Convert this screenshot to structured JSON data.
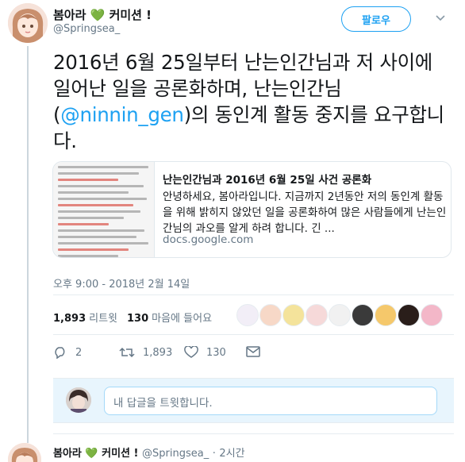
{
  "author": {
    "name": "봄아라",
    "badge": "커미션 !",
    "heart": "💚",
    "handle": "@Springsea_"
  },
  "follow_button": {
    "label": "팔로우"
  },
  "tweet": {
    "text_before": "2016년 6월 25일부터 난는인간님과 저 사이에 일어난 일을 공론화하며, 난는인간님(",
    "mention": "@ninnin_gen",
    "text_after": ")의 동인계 활동 중지를 요구합니다."
  },
  "card": {
    "title": "난는인간님과 2016년 6월 25일 사건 공론화",
    "description": "안녕하세요, 봄아라입니다. 지금까지 2년동안 저의 동인계 활동을 위해 밝히지 않았던 일을 공론화하여 많은 사람들에게 난는인간님의 과오를 알게 하려 합니다. 긴 ...",
    "domain": "docs.google.com"
  },
  "timestamp": "오후 9:00 - 2018년 2월 14일",
  "stats": {
    "retweets_count": "1,893",
    "retweets_label": "리트윗",
    "likes_count": "130",
    "likes_label": "마음에 들어요"
  },
  "actions": {
    "reply_count": "2",
    "retweet_count": "1,893",
    "like_count": "130"
  },
  "reply": {
    "placeholder": "내 답글을 트윗합니다."
  },
  "next_tweet": {
    "name": "봄아라",
    "heart": "💚",
    "badge": "커미션 !",
    "handle": "@Springsea_",
    "separator": "·",
    "time": "2시간"
  },
  "colors": {
    "accent": "#1da1f2",
    "muted": "#657786",
    "heart_green": "#5a9c3a",
    "reply_bg": "#e8f5fd"
  }
}
